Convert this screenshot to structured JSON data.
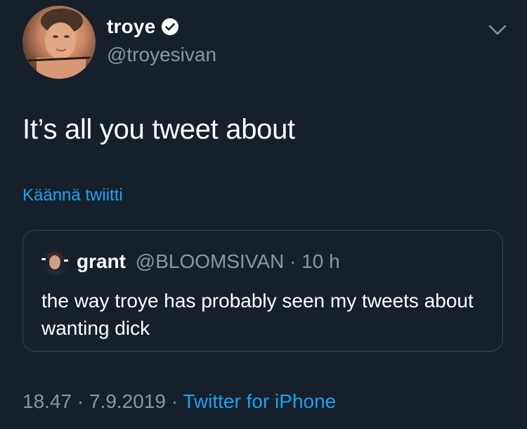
{
  "author": {
    "name": "troye",
    "handle": "@troyesivan",
    "verified": true
  },
  "tweet": {
    "text": "It’s all you tweet about",
    "translate_label": "Käännä twiitti"
  },
  "quoted_tweet": {
    "name": "grant",
    "handle": "@BLOOMSIVAN",
    "separator": "·",
    "time": "10 h",
    "text": "the way troye has probably seen my tweets about wanting dick"
  },
  "meta": {
    "time": "18.47",
    "separator": "·",
    "date": "7.9.2019",
    "source": "Twitter for iPhone"
  },
  "colors": {
    "background": "#15202b",
    "accent": "#1da1f2",
    "secondary_text": "#8899a6",
    "border": "#38444d"
  },
  "icons": {
    "verified": "verified-badge-icon",
    "more": "chevron-down-icon"
  }
}
